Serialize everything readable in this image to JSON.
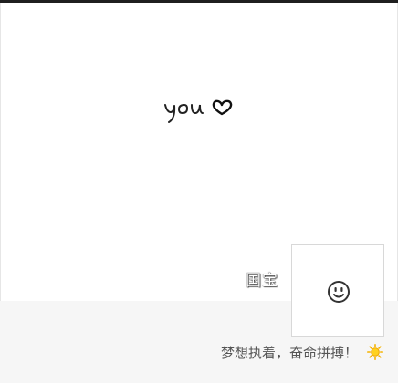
{
  "profile": {
    "username": "国宝",
    "signature": "梦想执着，奋命拼搏！",
    "cover_icon": "you-heart-doodle",
    "avatar_icon": "smiley-face-icon",
    "signature_emoji": "sun-icon"
  },
  "colors": {
    "top_bar": "#1f1f1f",
    "info_background": "#f6f6f6",
    "signature_text": "#555555",
    "sun": "#f5b400"
  }
}
